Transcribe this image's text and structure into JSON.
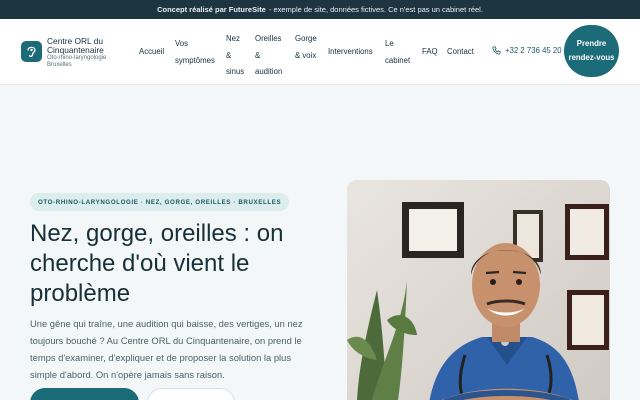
{
  "notice": {
    "bold": "Concept réalisé par FutureSite",
    "rest": "- exemple de site, données fictives. Ce n'est pas un cabinet réel."
  },
  "brand": {
    "title": "Centre ORL du Cinquantenaire",
    "subtitle": "Oto-rhino-laryngologie · Bruxelles"
  },
  "nav": {
    "items": [
      {
        "label": "Accueil"
      },
      {
        "label": "Vos symptômes"
      },
      {
        "label": "Nez & sinus"
      },
      {
        "label": "Oreilles & audition"
      },
      {
        "label": "Gorge & voix"
      },
      {
        "label": "Interventions"
      },
      {
        "label": "Le cabinet"
      },
      {
        "label": "FAQ"
      },
      {
        "label": "Contact"
      }
    ],
    "phone": "+32 2 736 45 20",
    "cta": "Prendre rendez-vous"
  },
  "hero": {
    "badge": "OTO-RHINO-LARYNGOLOGIE · NEZ, GORGE, OREILLES · BRUXELLES",
    "title": "Nez, gorge, oreilles : on cherche d'où vient le problème",
    "lead": "Une gêne qui traîne, une audition qui baisse, des vertiges, un nez toujours bouché ? Au Centre ORL du Cinquantenaire, on prend le temps d'examiner, d'expliquer et de proposer la solution la plus simple d'abord. On n'opère jamais sans raison."
  },
  "colors": {
    "accent": "#1c6b78",
    "notice_bg": "#1d3541",
    "text": "#17303a"
  },
  "icons": {
    "logo": "ear-icon",
    "phone": "phone-icon"
  }
}
